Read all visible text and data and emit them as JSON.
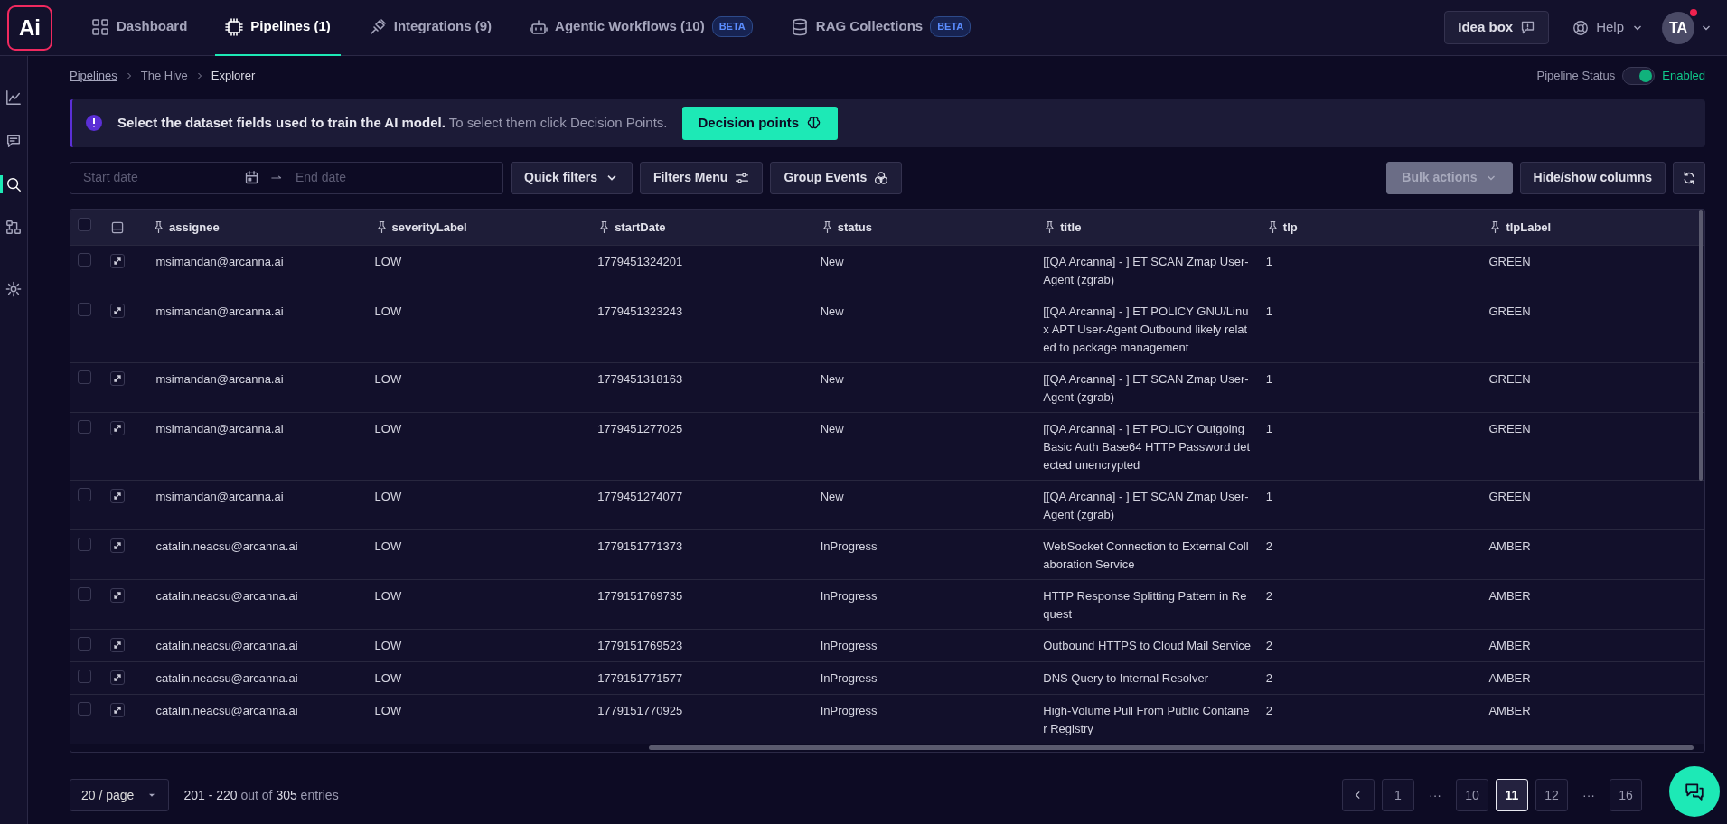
{
  "logo": {
    "text": "Ai"
  },
  "nav_tabs": [
    {
      "label": "Dashboard",
      "selected": false
    },
    {
      "label": "Pipelines (1)",
      "selected": true
    },
    {
      "label": "Integrations (9)",
      "selected": false
    },
    {
      "label": "Agentic Workflows (10)",
      "badge": "BETA",
      "selected": false
    },
    {
      "label": "RAG Collections",
      "badge": "BETA",
      "selected": false
    }
  ],
  "header_actions": {
    "idea_box": "Idea box",
    "help": "Help",
    "avatar": "TA",
    "notification": true
  },
  "sidebar": [
    {
      "selected": false
    },
    {
      "selected": false
    },
    {
      "selected": true
    },
    {
      "selected": false
    },
    {
      "selected": false
    }
  ],
  "breadcrumb": [
    {
      "label": "Pipelines",
      "link": true
    },
    {
      "label": "The Hive",
      "link": false
    },
    {
      "label": "Explorer",
      "link": false
    }
  ],
  "pipeline_status": {
    "label": "Pipeline Status",
    "on": true,
    "value": "Enabled"
  },
  "banner": {
    "text": "**Select the dataset fields used to train the AI model.** To select them click Decision Points.",
    "button": "Decision points"
  },
  "toolbar": {
    "start_placeholder": "Start date",
    "end_placeholder": "End date",
    "buttons": [
      "Quick filters",
      "Filters Menu",
      "Group Events"
    ],
    "bulk_actions": {
      "label": "Bulk actions",
      "disabled": true
    },
    "columns_button": "Hide/show columns"
  },
  "table": {
    "select_all": false,
    "columns": [
      "assignee",
      "severityLabel",
      "startDate",
      "status",
      "title",
      "tlp",
      "tlpLabel"
    ],
    "rows": [
      {
        "checked": false,
        "cells": [
          "msimandan@arcanna.ai",
          "LOW",
          "1779451324201",
          "New",
          "[[QA Arcanna] - ] ET SCAN Zmap User-Agent (zgrab)",
          "1",
          "GREEN"
        ]
      },
      {
        "checked": false,
        "cells": [
          "msimandan@arcanna.ai",
          "LOW",
          "1779451323243",
          "New",
          "[[QA Arcanna] - ] ET POLICY GNU/Linux APT User-Agent Outbound likely related to package management",
          "1",
          "GREEN"
        ]
      },
      {
        "checked": false,
        "cells": [
          "msimandan@arcanna.ai",
          "LOW",
          "1779451318163",
          "New",
          "[[QA Arcanna] - ] ET SCAN Zmap User-Agent (zgrab)",
          "1",
          "GREEN"
        ]
      },
      {
        "checked": false,
        "cells": [
          "msimandan@arcanna.ai",
          "LOW",
          "1779451277025",
          "New",
          "[[QA Arcanna] - ] ET POLICY Outgoing Basic Auth Base64 HTTP Password detected unencrypted",
          "1",
          "GREEN"
        ]
      },
      {
        "checked": false,
        "cells": [
          "msimandan@arcanna.ai",
          "LOW",
          "1779451274077",
          "New",
          "[[QA Arcanna] - ] ET SCAN Zmap User-Agent (zgrab)",
          "1",
          "GREEN"
        ]
      },
      {
        "checked": false,
        "cells": [
          "catalin.neacsu@arcanna.ai",
          "LOW",
          "1779151771373",
          "InProgress",
          "WebSocket Connection to External Collaboration Service",
          "2",
          "AMBER"
        ]
      },
      {
        "checked": false,
        "cells": [
          "catalin.neacsu@arcanna.ai",
          "LOW",
          "1779151769735",
          "InProgress",
          "HTTP Response Splitting Pattern in Request",
          "2",
          "AMBER"
        ]
      },
      {
        "checked": false,
        "cells": [
          "catalin.neacsu@arcanna.ai",
          "LOW",
          "1779151769523",
          "InProgress",
          "Outbound HTTPS to Cloud Mail Service",
          "2",
          "AMBER"
        ]
      },
      {
        "checked": false,
        "cells": [
          "catalin.neacsu@arcanna.ai",
          "LOW",
          "1779151771577",
          "InProgress",
          "DNS Query to Internal Resolver",
          "2",
          "AMBER"
        ]
      },
      {
        "checked": false,
        "cells": [
          "catalin.neacsu@arcanna.ai",
          "LOW",
          "1779151770925",
          "InProgress",
          "High-Volume Pull From Public Container Registry",
          "2",
          "AMBER"
        ]
      }
    ]
  },
  "pagination": {
    "page_size": "20 / page",
    "summary": "**201 - 220** out of **305** entries",
    "pages": [
      {
        "label": "1",
        "kind": "page",
        "selected": false
      },
      {
        "label": "···",
        "kind": "gap"
      },
      {
        "label": "10",
        "kind": "page",
        "selected": false
      },
      {
        "label": "11",
        "kind": "page",
        "selected": true
      },
      {
        "label": "12",
        "kind": "page",
        "selected": false
      },
      {
        "label": "···",
        "kind": "gap"
      },
      {
        "label": "16",
        "kind": "page",
        "selected": false
      }
    ]
  }
}
